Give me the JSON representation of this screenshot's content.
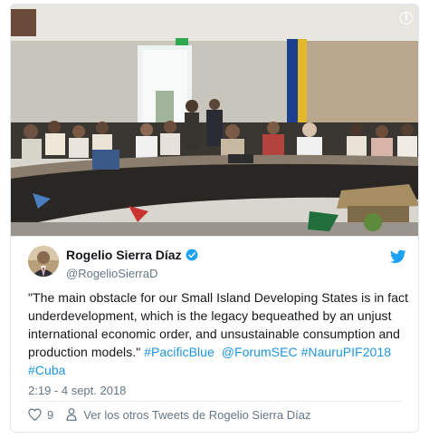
{
  "tweet": {
    "author_name": "Rogelio Sierra Díaz",
    "author_handle": "@RogelioSierraD",
    "text_main": "\"The main obstacle for our Small Island Developing States is in fact underdevelopment, which is the legacy bequeathed by an unjust international economic order, and unsustainable consumption and production models.\"",
    "hashtags": [
      "#PacificBlue",
      "@ForumSEC",
      "#NauruPIF2018",
      "#Cuba"
    ],
    "timestamp": "2:19 - 4 sept. 2018",
    "like_count": "9",
    "more_tweets_label": "Ver los otros Tweets de Rogelio Sierra Díaz"
  },
  "icons": {
    "info": "info-icon",
    "verified": "verified-badge-icon",
    "bird": "twitter-bird-icon",
    "heart": "heart-icon",
    "person": "person-icon"
  },
  "colors": {
    "link": "#1b95e0",
    "text": "#14171a",
    "muted": "#657786",
    "twitter_blue": "#1da1f2"
  }
}
